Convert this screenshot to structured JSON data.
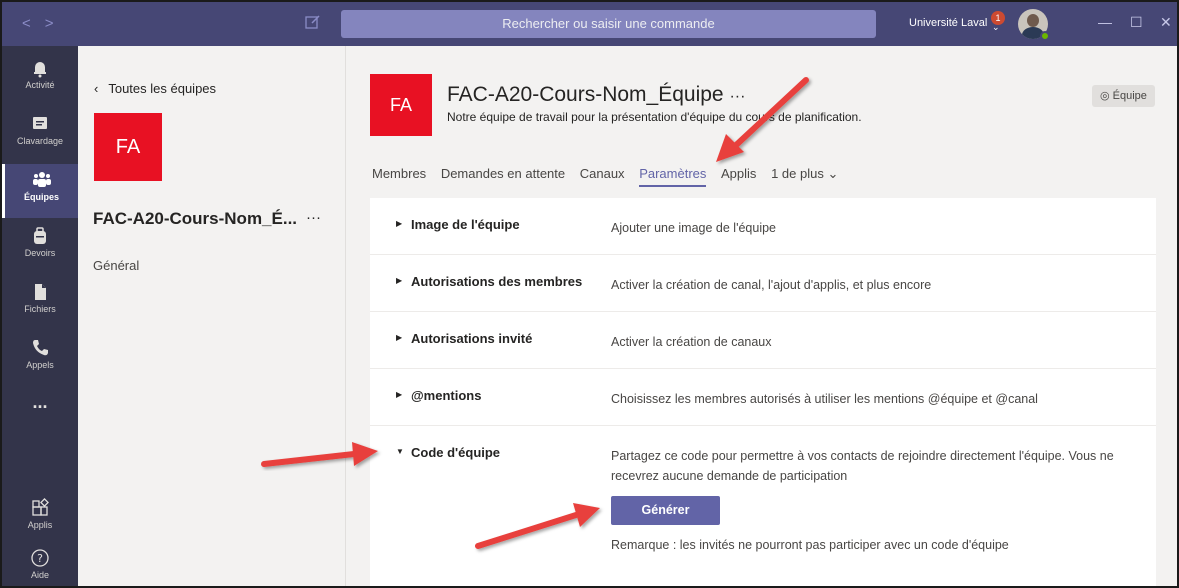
{
  "titlebar": {
    "search_placeholder": "Rechercher ou saisir une commande",
    "org_name": "Université Laval",
    "notification_count": "1"
  },
  "rail": {
    "items": [
      {
        "label": "Activité",
        "icon": "bell-icon"
      },
      {
        "label": "Clavardage",
        "icon": "chat-icon"
      },
      {
        "label": "Équipes",
        "icon": "teams-icon",
        "active": true
      },
      {
        "label": "Devoirs",
        "icon": "backpack-icon"
      },
      {
        "label": "Fichiers",
        "icon": "file-icon"
      },
      {
        "label": "Appels",
        "icon": "phone-icon"
      },
      {
        "label": "...",
        "icon": "more-icon"
      },
      {
        "label": "Applis",
        "icon": "apps-icon"
      },
      {
        "label": "Aide",
        "icon": "help-icon"
      }
    ]
  },
  "teampanel": {
    "back_label": "Toutes les équipes",
    "tile_initials": "FA",
    "team_name": "FAC-A20-Cours-Nom_É...",
    "more": "···",
    "channels": [
      "Général"
    ]
  },
  "main": {
    "tile_initials": "FA",
    "title": "FAC-A20-Cours-Nom_Équipe",
    "title_more": "···",
    "description": "Notre équipe de travail pour la présentation d'équipe du cours de planification.",
    "team_badge": "Équipe",
    "tabs": [
      {
        "label": "Membres"
      },
      {
        "label": "Demandes en attente"
      },
      {
        "label": "Canaux"
      },
      {
        "label": "Paramètres",
        "active": true
      },
      {
        "label": "Applis"
      },
      {
        "label": "1 de plus"
      }
    ],
    "settings": [
      {
        "title": "Image de l'équipe",
        "desc": "Ajouter une image de l'équipe",
        "expanded": false
      },
      {
        "title": "Autorisations des membres",
        "desc": "Activer la création de canal, l'ajout d'applis, et plus encore",
        "expanded": false
      },
      {
        "title": "Autorisations invité",
        "desc": "Activer la création de canaux",
        "expanded": false
      },
      {
        "title": "@mentions",
        "desc": "Choisissez les membres autorisés à utiliser les mentions @équipe et @canal",
        "expanded": false
      },
      {
        "title": "Code d'équipe",
        "desc": "Partagez ce code pour permettre à vos contacts de rejoindre directement l'équipe. Vous ne recevrez aucune demande de participation",
        "expanded": true
      }
    ],
    "generate_label": "Générer",
    "note": "Remarque : les invités ne pourront pas participer avec un code d'équipe"
  },
  "colors": {
    "brand": "#464775",
    "accent": "#6264a7",
    "team_tile": "#e81123",
    "annotation_arrow": "#e8413c"
  }
}
